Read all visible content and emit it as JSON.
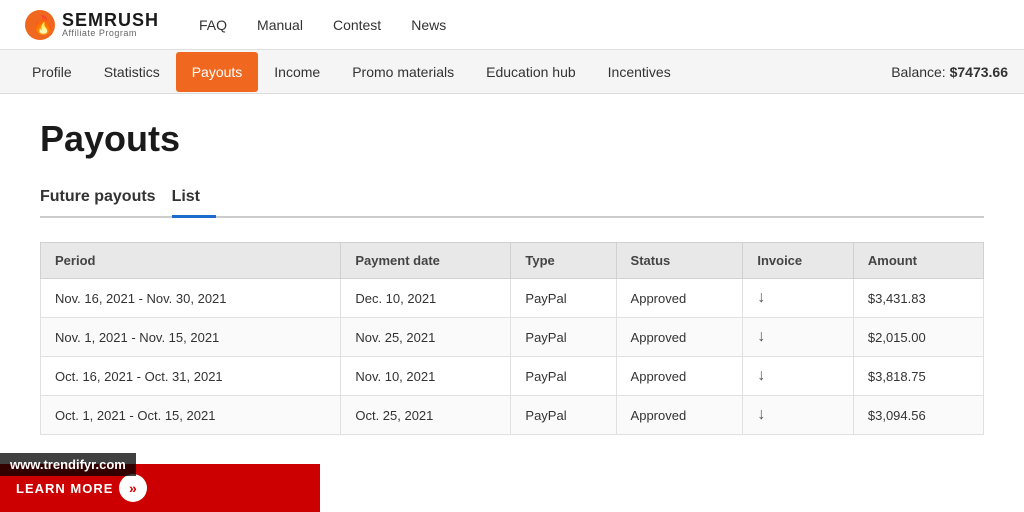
{
  "top_nav": {
    "logo_name": "SEMRUSH",
    "logo_sub": "Affiliate Program",
    "links": [
      "FAQ",
      "Manual",
      "Contest",
      "News"
    ]
  },
  "sub_nav": {
    "links": [
      "Profile",
      "Statistics",
      "Payouts",
      "Income",
      "Promo materials",
      "Education hub",
      "Incentives"
    ],
    "active": "Payouts",
    "balance_label": "Balance:",
    "balance_value": "$7473.66"
  },
  "page": {
    "title": "Payouts",
    "tabs": [
      "Future payouts",
      "List"
    ],
    "active_tab": "List"
  },
  "table": {
    "headers": [
      "Period",
      "Payment date",
      "Type",
      "Status",
      "Invoice",
      "Amount"
    ],
    "rows": [
      {
        "period": "Nov. 16, 2021 - Nov. 30, 2021",
        "payment_date": "Dec. 10, 2021",
        "type": "PayPal",
        "status": "Approved",
        "invoice": "download",
        "amount": "$3,431.83"
      },
      {
        "period": "Nov. 1, 2021 - Nov. 15, 2021",
        "payment_date": "Nov. 25, 2021",
        "type": "PayPal",
        "status": "Approved",
        "invoice": "download",
        "amount": "$2,015.00"
      },
      {
        "period": "Oct. 16, 2021 - Oct. 31, 2021",
        "payment_date": "Nov. 10, 2021",
        "type": "PayPal",
        "status": "Approved",
        "invoice": "download",
        "amount": "$3,818.75"
      },
      {
        "period": "Oct. 1, 2021 - Oct. 15, 2021",
        "payment_date": "Oct. 25, 2021",
        "type": "PayPal",
        "status": "Approved",
        "invoice": "download",
        "amount": "$3,094.56"
      }
    ]
  },
  "banner": {
    "learn_more_label": "LEARN MORE",
    "watermark": "www.trendifyr.com"
  }
}
